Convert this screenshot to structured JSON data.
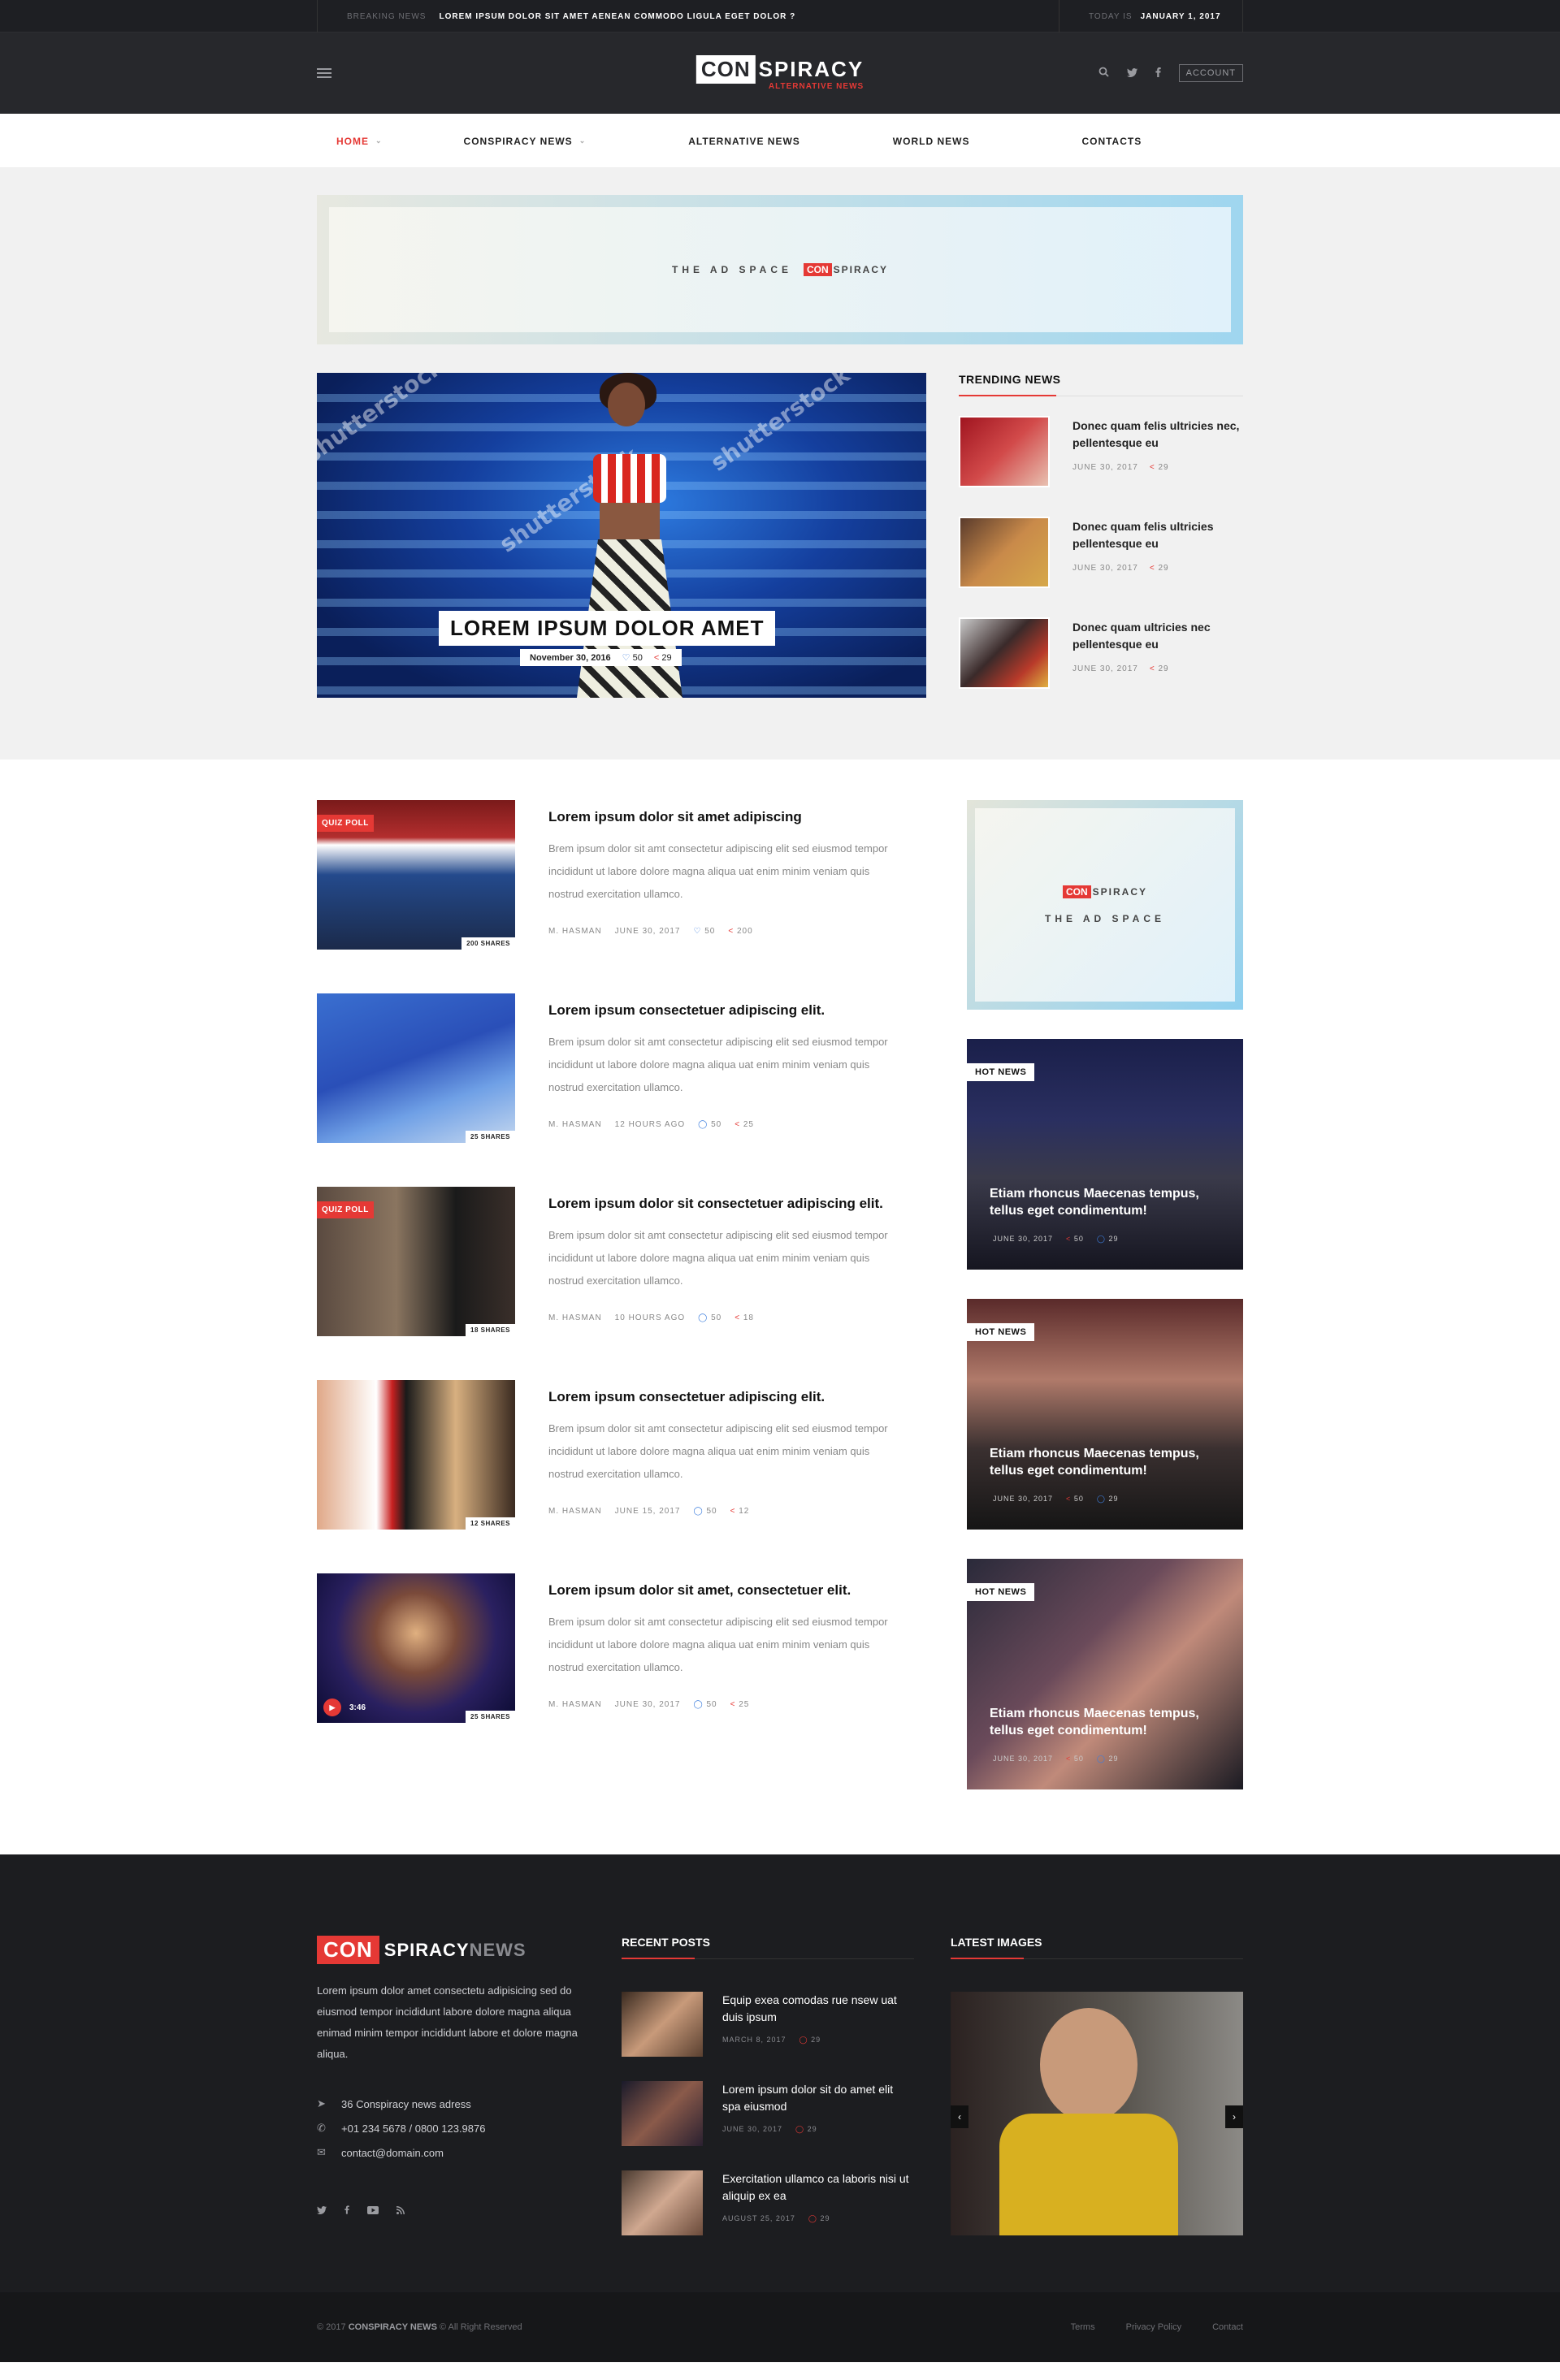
{
  "topbar": {
    "breaking_label": "BREAKING NEWS",
    "breaking_text": "LOREM IPSUM DOLOR SIT AMET AENEAN COMMODO LIGULA EGET DOLOR ?",
    "today_label": "TODAY IS",
    "today_date": "JANUARY 1, 2017"
  },
  "header": {
    "logo_con": "CON",
    "logo_spiracy": "SPIRACY",
    "logo_sub": "ALTERNATIVE NEWS",
    "account_label": "ACCOUNT",
    "icons": [
      "menu-icon",
      "search-icon",
      "twitter-icon",
      "facebook-icon"
    ]
  },
  "nav": {
    "items": [
      {
        "label": "HOME",
        "active": true,
        "has_dropdown": true
      },
      {
        "label": "CONSPIRACY NEWS",
        "active": false,
        "has_dropdown": true
      },
      {
        "label": "ALTERNATIVE NEWS",
        "active": false,
        "has_dropdown": false
      },
      {
        "label": "WORLD NEWS",
        "active": false,
        "has_dropdown": false
      },
      {
        "label": "CONTACTS",
        "active": false,
        "has_dropdown": false
      }
    ]
  },
  "ad_top": {
    "text": "THE AD SPACE",
    "logo_con": "CON",
    "logo_spiracy": "SPIRACY"
  },
  "featured": {
    "title": "LOREM IPSUM DOLOR AMET",
    "date": "November 30, 2016",
    "likes": "50",
    "shares": "29",
    "watermark": "shutterstock"
  },
  "trending": {
    "title": "TRENDING NEWS",
    "items": [
      {
        "title": "Donec quam felis ultricies nec, pellentesque eu",
        "date": "JUNE 30, 2017",
        "shares": "29"
      },
      {
        "title": "Donec quam felis ultricies pellentesque eu",
        "date": "JUNE 30, 2017",
        "shares": "29"
      },
      {
        "title": "Donec quam ultricies nec pellentesque eu",
        "date": "JUNE 30, 2017",
        "shares": "29"
      }
    ]
  },
  "posts": [
    {
      "badge": "QUIZ POLL",
      "shares_badge": "200 SHARES",
      "title": "Lorem ipsum dolor sit amet adipiscing",
      "excerpt": "Brem ipsum dolor sit amt consectetur adipiscing elit sed eiusmod tempor incididunt ut labore dolore magna aliqua uat enim minim veniam quis nostrud exercitation ullamco.",
      "author": "M. HASMAN",
      "date": "JUNE 30, 2017",
      "comments": "50",
      "shares": "200"
    },
    {
      "badge": "",
      "shares_badge": "25 SHARES",
      "title": "Lorem ipsum consectetuer adipiscing elit.",
      "excerpt": "Brem ipsum dolor sit amt consectetur adipiscing elit sed eiusmod tempor incididunt ut labore dolore magna aliqua uat enim minim veniam quis nostrud exercitation ullamco.",
      "author": "M. HASMAN",
      "date": "12 HOURS AGO",
      "comments": "50",
      "shares": "25"
    },
    {
      "badge": "QUIZ POLL",
      "shares_badge": "18 SHARES",
      "title": "Lorem ipsum dolor sit consectetuer adipiscing elit.",
      "excerpt": "Brem ipsum dolor sit amt consectetur adipiscing elit sed eiusmod tempor incididunt ut labore dolore magna aliqua uat enim minim veniam quis nostrud exercitation ullamco.",
      "author": "M. HASMAN",
      "date": "10 HOURS AGO",
      "comments": "50",
      "shares": "18"
    },
    {
      "badge": "",
      "shares_badge": "12 SHARES",
      "title": "Lorem ipsum consectetuer adipiscing elit.",
      "excerpt": "Brem ipsum dolor sit amt consectetur adipiscing elit sed eiusmod tempor incididunt ut labore dolore magna aliqua uat enim minim veniam quis nostrud exercitation ullamco.",
      "author": "M. HASMAN",
      "date": "JUNE 15, 2017",
      "comments": "50",
      "shares": "12"
    },
    {
      "badge": "",
      "shares_badge": "25 SHARES",
      "video_duration": "3:46",
      "title": "Lorem ipsum dolor sit amet, consectetuer elit.",
      "excerpt": "Brem ipsum dolor sit amt consectetur adipiscing elit sed eiusmod tempor incididunt ut labore dolore magna aliqua uat enim minim veniam quis nostrud exercitation ullamco.",
      "author": "M. HASMAN",
      "date": "JUNE 30, 2017",
      "comments": "50",
      "shares": "25"
    }
  ],
  "ad_side": {
    "logo_con": "CON",
    "logo_spiracy": "SPIRACY",
    "text": "THE AD SPACE"
  },
  "hot_news": [
    {
      "badge": "HOT NEWS",
      "title": "Etiam rhoncus Maecenas tempus, tellus eget condimentum!",
      "date": "JUNE 30, 2017",
      "shares": "50",
      "comments": "29"
    },
    {
      "badge": "HOT NEWS",
      "title": "Etiam rhoncus Maecenas tempus, tellus eget condimentum!",
      "date": "JUNE 30, 2017",
      "shares": "50",
      "comments": "29"
    },
    {
      "badge": "HOT NEWS",
      "title": "Etiam rhoncus Maecenas tempus, tellus eget condimentum!",
      "date": "JUNE 30, 2017",
      "shares": "50",
      "comments": "29"
    }
  ],
  "footer": {
    "logo_con": "CON",
    "logo_spiracy": "SPIRACY",
    "logo_news": "NEWS",
    "description": "Lorem ipsum dolor amet consectetu adipisicing sed do eiusmod tempor incididunt labore dolore magna aliqua enimad minim tempor incididunt labore et dolore magna aliqua.",
    "address": "36 Conspiracy news adress",
    "phone": "+01 234 5678  /  0800 123.9876",
    "email": "contact@domain.com",
    "recent_title": "RECENT POSTS",
    "recent": [
      {
        "title": "Equip exea comodas rue nsew uat duis ipsum",
        "date": "MARCH 8, 2017",
        "comments": "29"
      },
      {
        "title": "Lorem ipsum dolor sit do amet elit spa eiusmod",
        "date": "JUNE 30, 2017",
        "comments": "29"
      },
      {
        "title": "Exercitation ullamco ca laboris nisi ut aliquip ex ea",
        "date": "AUGUST 25, 2017",
        "comments": "29"
      }
    ],
    "latest_title": "LATEST IMAGES"
  },
  "bottom": {
    "copyright_prefix": "© 2017",
    "copyright_brand": "CONSPIRACY NEWS",
    "copyright_suffix": "© All Right Reserved",
    "links": [
      "Terms",
      "Privacy Policy",
      "Contact"
    ]
  },
  "colors": {
    "accent": "#e53935",
    "dark": "#27282c",
    "link_blue": "#3b7ddd"
  }
}
